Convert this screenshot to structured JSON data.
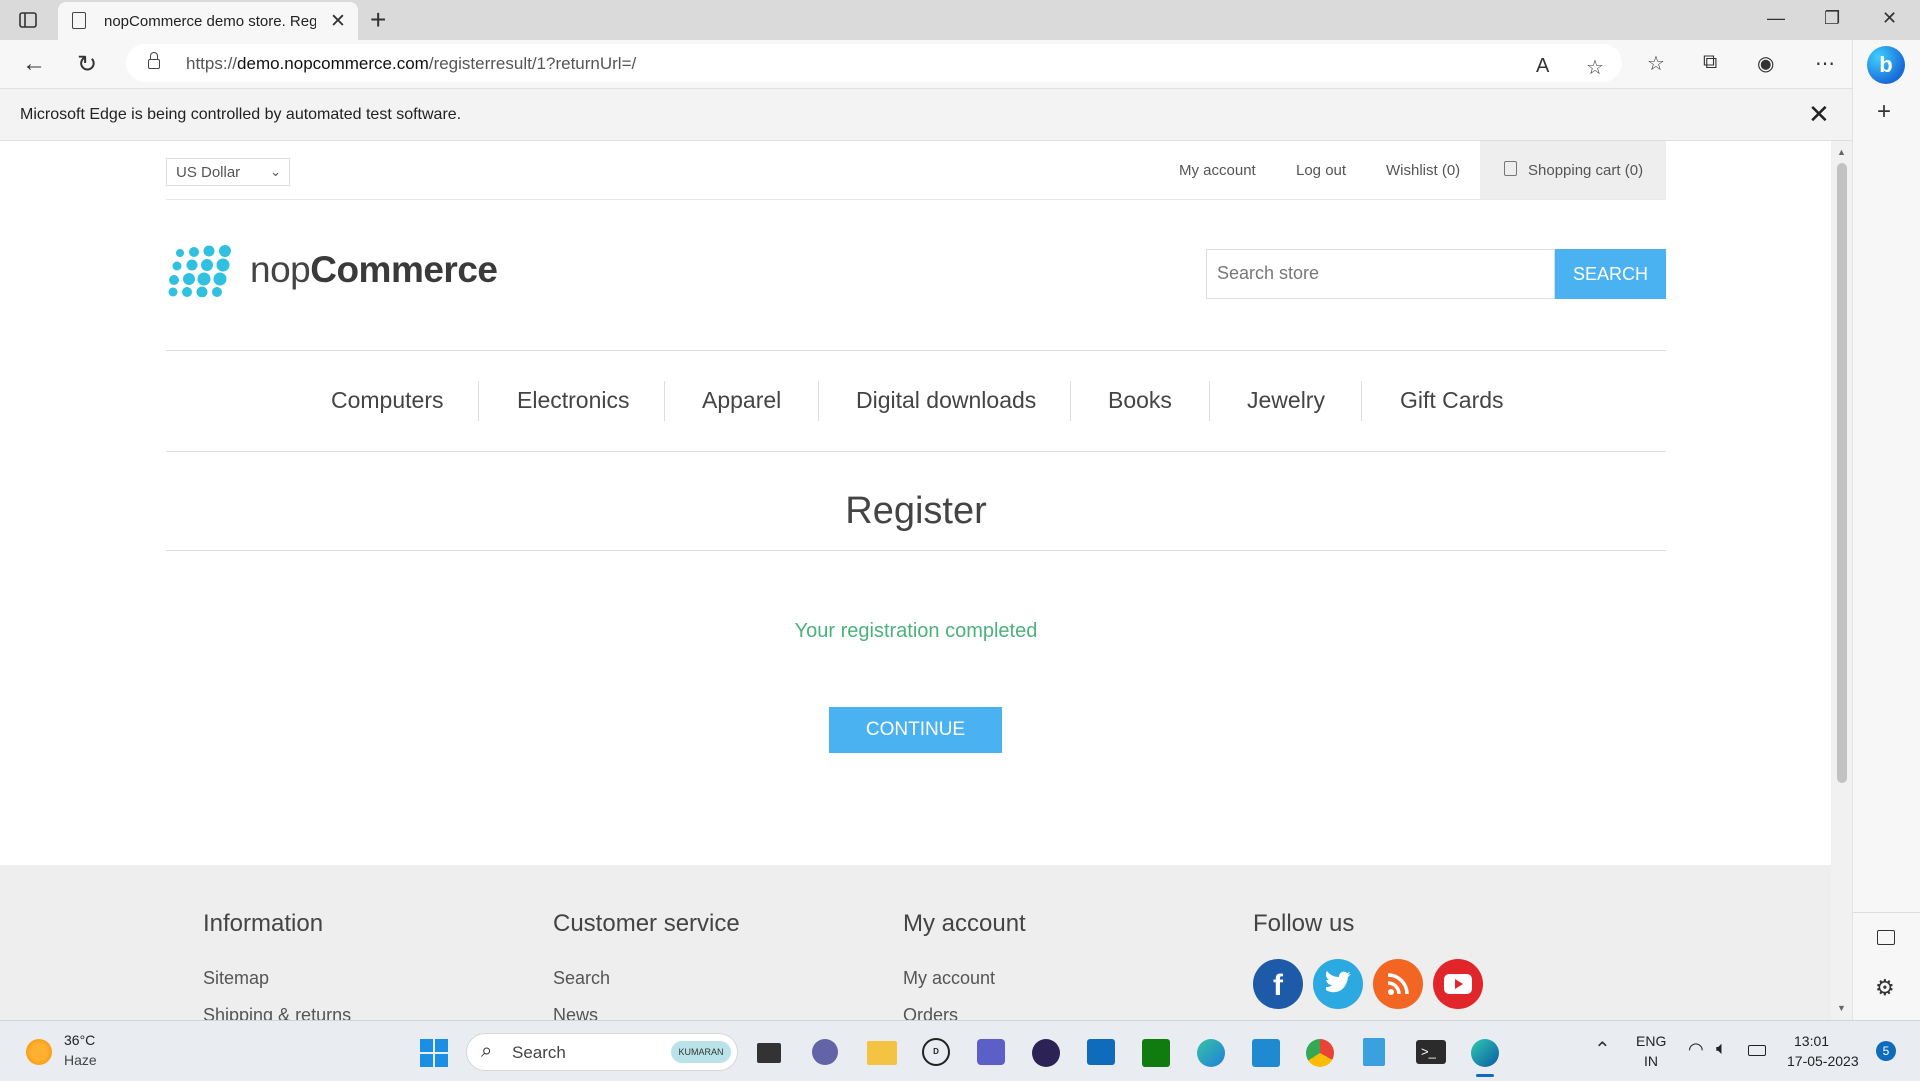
{
  "browser": {
    "tab_title": "nopCommerce demo store. Register",
    "url_prefix": "https://",
    "url_host": "demo.nopcommerce.com",
    "url_path": "/registerresult/1?returnUrl=/",
    "infobar_message": "Microsoft Edge is being controlled by automated test software."
  },
  "header": {
    "currency": "US Dollar",
    "links": [
      "My account",
      "Log out",
      "Wishlist (0)"
    ],
    "cart": "Shopping cart (0)"
  },
  "logo": {
    "light": "nop",
    "bold": "Commerce"
  },
  "search": {
    "placeholder": "Search store",
    "button": "SEARCH"
  },
  "menu": [
    "Computers",
    "Electronics",
    "Apparel",
    "Digital downloads",
    "Books",
    "Jewelry",
    "Gift Cards"
  ],
  "main": {
    "title": "Register",
    "result": "Your registration completed",
    "continue": "CONTINUE"
  },
  "footer": {
    "information": {
      "title": "Information",
      "links": [
        "Sitemap",
        "Shipping & returns"
      ]
    },
    "customer_service": {
      "title": "Customer service",
      "links": [
        "Search",
        "News"
      ]
    },
    "my_account": {
      "title": "My account",
      "links": [
        "My account",
        "Orders"
      ]
    },
    "follow_us": {
      "title": "Follow us",
      "icons": [
        "facebook-icon",
        "twitter-icon",
        "rss-icon",
        "youtube-icon"
      ]
    }
  },
  "taskbar": {
    "weather_temp": "36°C",
    "weather_desc": "Haze",
    "search_label": "Search",
    "search_badge": "KUMARAN",
    "lang": "ENG",
    "region": "IN",
    "time": "13:01",
    "date": "17-05-2023",
    "notifications": "5"
  },
  "colors": {
    "accent": "#4ab2f1",
    "success": "#4cb17c",
    "footer_bg": "#eeeeee"
  }
}
